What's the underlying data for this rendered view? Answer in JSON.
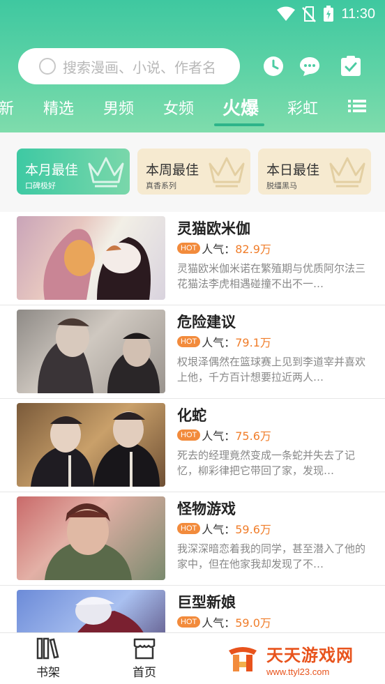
{
  "status_bar": {
    "time": "11:30"
  },
  "search": {
    "placeholder": "搜索漫画、小说、作者名"
  },
  "header_icons": [
    "clock-icon",
    "chat-icon",
    "checklist-icon"
  ],
  "tabs": [
    {
      "label": "新"
    },
    {
      "label": "精选"
    },
    {
      "label": "男频"
    },
    {
      "label": "女频"
    },
    {
      "label": "火爆",
      "active": true
    },
    {
      "label": "彩虹"
    }
  ],
  "rank_cards": [
    {
      "title": "本月最佳",
      "subtitle": "口碑极好"
    },
    {
      "title": "本周最佳",
      "subtitle": "真香系列"
    },
    {
      "title": "本日最佳",
      "subtitle": "脱缰黑马"
    }
  ],
  "hot_badge": "HOT",
  "popularity_label": "人气：",
  "comics": [
    {
      "title": "灵猫欧米伽",
      "popularity": "82.9万",
      "desc": "灵猫欧米伽米诺在繁殖期与优质阿尔法三花猫法李虎相遇碰撞不出不一…"
    },
    {
      "title": "危险建议",
      "popularity": "79.1万",
      "desc": "权垠泽偶然在篮球赛上见到李道宰并喜欢上他，千方百计想要拉近两人…"
    },
    {
      "title": "化蛇",
      "popularity": "75.6万",
      "desc": "死去的经理竟然变成一条蛇并失去了记忆，柳彩律把它带回了家，发现…"
    },
    {
      "title": "怪物游戏",
      "popularity": "59.6万",
      "desc": "我深深暗恋着我的同学，甚至潜入了他的家中，但在他家我却发现了不…"
    },
    {
      "title": "巨型新娘",
      "popularity": "59.0万",
      "desc": ""
    }
  ],
  "bottom_nav": [
    {
      "label": "书架"
    },
    {
      "label": "首页"
    }
  ],
  "watermark": {
    "name": "天天游戏网",
    "url": "www.ttyl23.com"
  },
  "colors": {
    "accent": "#3fc8a0",
    "hot": "#f28b3c",
    "popularity": "#f07d2a",
    "watermark": "#e8531c"
  }
}
